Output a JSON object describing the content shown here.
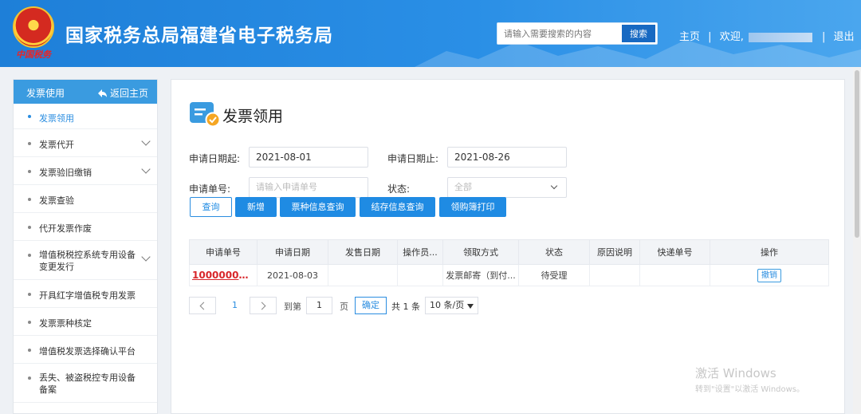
{
  "header": {
    "emblem_icon": "tax-emblem-icon",
    "seal_text": "中国税务",
    "title": "国家税务总局福建省电子税务局",
    "search_placeholder": "请输入需要搜索的内容",
    "search_button": "搜索",
    "nav_home": "主页",
    "nav_separator": "|",
    "nav_welcome": "欢迎,",
    "nav_logout": "退出"
  },
  "sidebar": {
    "title": "发票使用",
    "back_icon": "back-arrow-icon",
    "back_label": "返回主页",
    "items": [
      {
        "label": "发票领用",
        "active": true,
        "has_sub": false
      },
      {
        "label": "发票代开",
        "active": false,
        "has_sub": true
      },
      {
        "label": "发票验旧缴销",
        "active": false,
        "has_sub": true
      },
      {
        "label": "发票查验",
        "active": false,
        "has_sub": false
      },
      {
        "label": "代开发票作废",
        "active": false,
        "has_sub": false
      },
      {
        "label": "增值税税控系统专用设备变更发行",
        "active": false,
        "has_sub": true
      },
      {
        "label": "开具红字增值税专用发票",
        "active": false,
        "has_sub": false
      },
      {
        "label": "发票票种核定",
        "active": false,
        "has_sub": false
      },
      {
        "label": "增值税发票选择确认平台",
        "active": false,
        "has_sub": false
      },
      {
        "label": "丢失、被盗税控专用设备备案",
        "active": false,
        "has_sub": false
      }
    ]
  },
  "main": {
    "title": "发票领用",
    "title_icon": "invoice-icon",
    "form": {
      "start_date_label": "申请日期起:",
      "start_date_value": "2021-08-01",
      "end_date_label": "申请日期止:",
      "end_date_value": "2021-08-26",
      "order_no_label": "申请单号:",
      "order_no_placeholder": "请输入申请单号",
      "status_label": "状态:",
      "status_value": "全部"
    },
    "buttons": {
      "query": "查询",
      "add": "新增",
      "type_info_query": "票种信息查询",
      "stock_info_query": "结存信息查询",
      "purchase_print": "领购簿打印"
    },
    "table": {
      "columns": [
        "申请单号",
        "申请日期",
        "发售日期",
        "操作员...",
        "领取方式",
        "状态",
        "原因说明",
        "快递单号",
        "操作"
      ],
      "rows": [
        {
          "order_no": "1000000000...",
          "apply_date": "2021-08-03",
          "sale_date": "",
          "operator": "",
          "method": "发票邮寄（到付...",
          "status": "待受理",
          "reason": "",
          "express_no": "",
          "action": "撤销"
        }
      ]
    },
    "pager": {
      "current_page": "1",
      "goto_label": "到第",
      "goto_value": "1",
      "page_unit": "页",
      "confirm": "确定",
      "total": "共 1 条",
      "page_size": "10 条/页"
    }
  },
  "watermark": {
    "line1": "激活 Windows",
    "line2": "转到\"设置\"以激活 Windows。"
  }
}
